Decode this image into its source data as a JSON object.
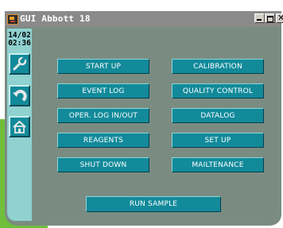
{
  "window": {
    "title": "GUI Abbott 18",
    "controls": [
      "minimize",
      "maximize",
      "close"
    ]
  },
  "sidebar": {
    "date": "14/02",
    "time": "02:36",
    "buttons": [
      {
        "icon": "wrench-icon"
      },
      {
        "icon": "back-arrow-icon"
      },
      {
        "icon": "home-icon"
      }
    ]
  },
  "menu": {
    "start_up": "START UP",
    "calibration": "CALIBRATION",
    "event_log": "EVENT LOG",
    "quality_control": "QUALITY CONTROL",
    "oper_log": "OPER. LOG IN/OUT",
    "datalog": "DATALOG",
    "reagents": "REAGENTS",
    "set_up": "SET UP",
    "shut_down": "SHUT DOWN",
    "maintenance": "MAILTENANCE",
    "run_sample": "RUN SAMPLE"
  },
  "colors": {
    "button": "#128a9a",
    "sidebar": "#8fd2d0",
    "window": "#7a8c82",
    "titlebar": "#8a8a8a",
    "accent_green": "#6fbf3a"
  }
}
